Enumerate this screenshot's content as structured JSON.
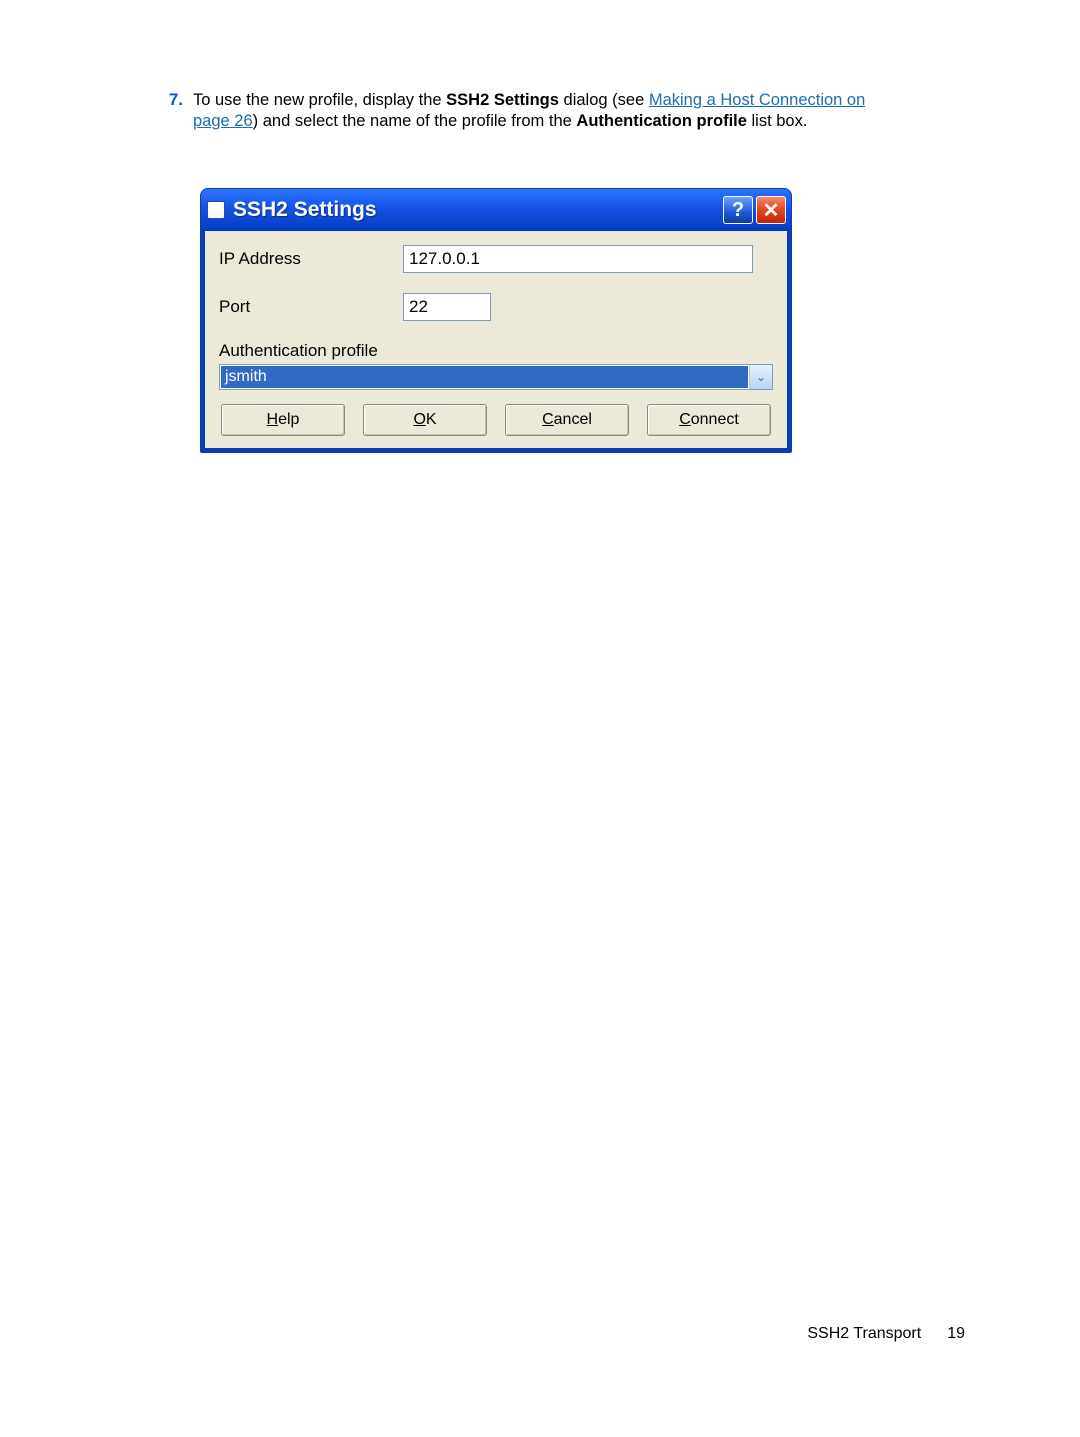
{
  "step": {
    "number": "7.",
    "text_pre": "To use the new profile, display the ",
    "bold1": "SSH2 Settings",
    "text_mid1": " dialog (see ",
    "link_text": "Making a Host Connection on page 26",
    "text_mid2": ") and select the name of the profile from the ",
    "bold2": "Authentication profile",
    "text_post": " list box."
  },
  "dialog": {
    "title": "SSH2 Settings",
    "help_symbol": "?",
    "close_symbol": "✕",
    "fields": {
      "ip_label": "IP Address",
      "ip_value": "127.0.0.1",
      "port_label": "Port",
      "port_value": "22",
      "auth_label": "Authentication profile",
      "auth_selected": "jsmith",
      "dropdown_glyph": "⌄"
    },
    "buttons": {
      "help": {
        "mnemonic": "H",
        "rest": "elp"
      },
      "ok": {
        "mnemonic": "O",
        "rest": "K"
      },
      "cancel": {
        "mnemonic": "C",
        "rest": "ancel"
      },
      "connect": {
        "mnemonic": "C",
        "rest": "onnect"
      }
    }
  },
  "footer": {
    "section": "SSH2 Transport",
    "page": "19"
  }
}
